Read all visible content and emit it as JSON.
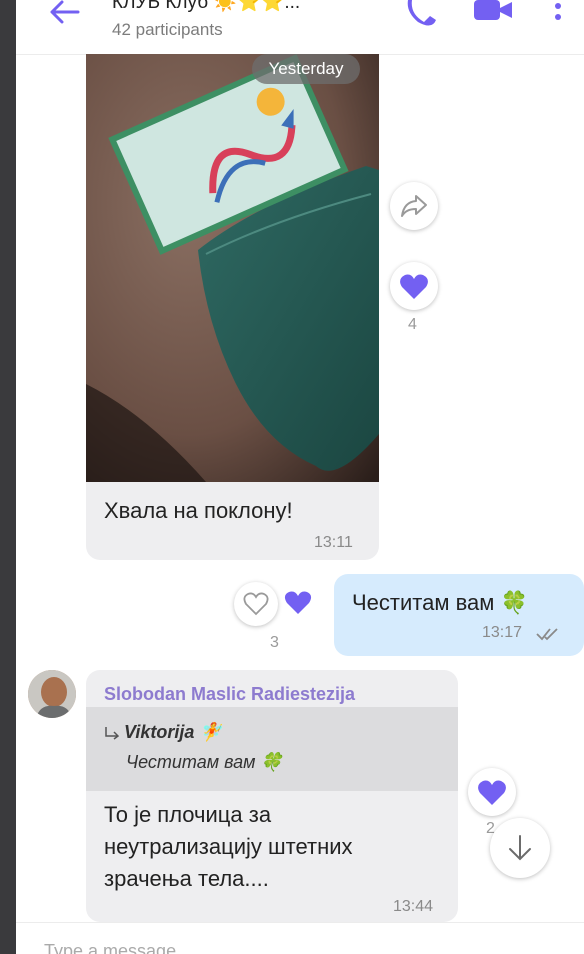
{
  "header": {
    "title": "КЛУБ Клуб ☀️⭐⭐...",
    "participants": "42 participants"
  },
  "photo_message": {
    "date_tag": "Yesterday",
    "caption": "Хвала на поклону!",
    "time": "13:11",
    "reactions_count": "4"
  },
  "outgoing_message": {
    "text": "Честитам вам 🍀",
    "time": "13:17",
    "reactions_count": "3"
  },
  "reply_message": {
    "sender": "Slobodan Maslic Radiestezija",
    "quoted_author": "Viktorija 🧚",
    "quoted_text": "Честитам вам 🍀",
    "text_line1": "То је плочица за",
    "text_line2": "неутрализацију штетних",
    "text_line3": "зрачења тела....",
    "time": "13:44",
    "reactions_count": "2"
  },
  "composer": {
    "placeholder": "Type a message..."
  },
  "colors": {
    "accent": "#7360f2",
    "outgoing_bubble": "#d6ebfd",
    "incoming_bubble": "#eeeef0"
  }
}
